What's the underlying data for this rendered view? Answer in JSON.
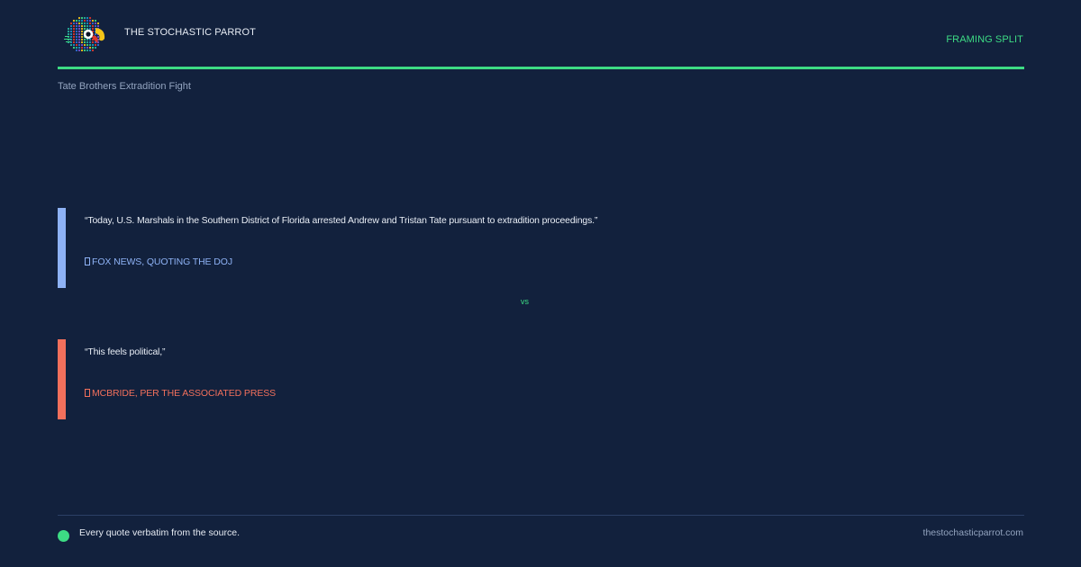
{
  "header": {
    "brand": "THE STOCHASTIC PARROT",
    "label": "FRAMING SPLIT",
    "logo_icon": "parrot-logo-icon"
  },
  "story": {
    "title": "Tate Brothers Extradition Fight"
  },
  "quotes": [
    {
      "text": "“Today, U.S. Marshals in the Southern District of Florida arrested Andrew and Tristan Tate pursuant to extradition proceedings.”",
      "attribution": "FOX NEWS, QUOTING THE DOJ",
      "color": "#8eb2f5"
    },
    {
      "text": "“This feels political,”",
      "attribution": "MCBRIDE, PER THE ASSOCIATED PRESS",
      "color": "#f2705c"
    }
  ],
  "divider": "vs",
  "footer": {
    "note": "Every quote verbatim from the source.",
    "site": "thestochasticparrot.com"
  },
  "colors": {
    "background": "#12213d",
    "accent": "#3ddc84"
  }
}
